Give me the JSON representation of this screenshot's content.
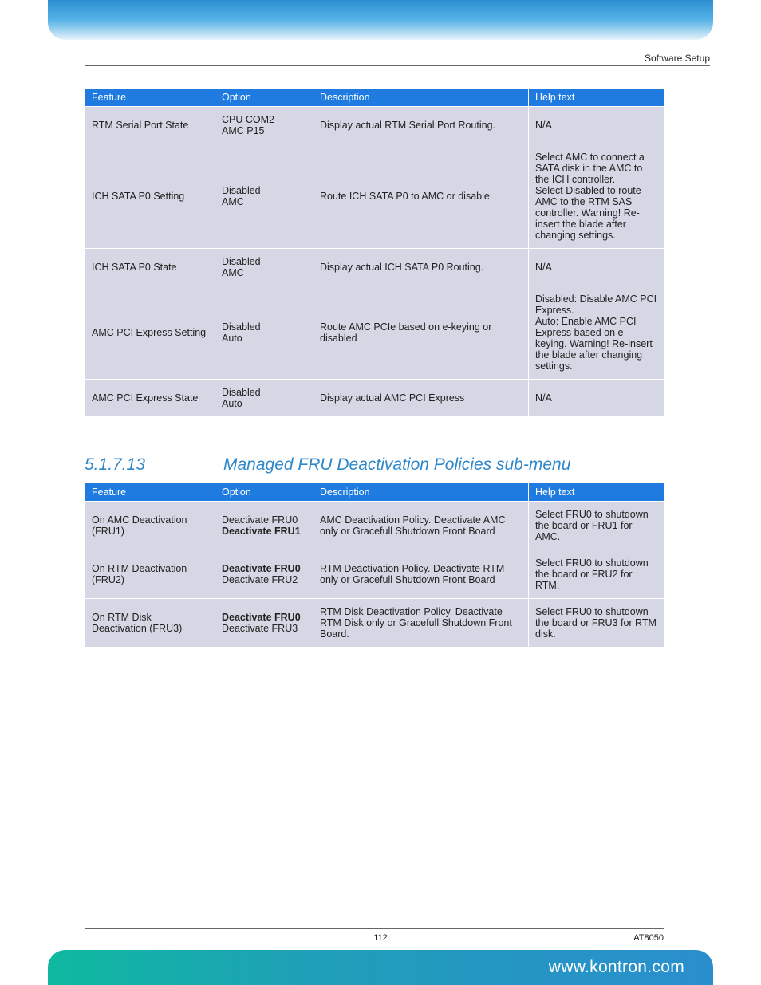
{
  "header": {
    "label": "Software Setup"
  },
  "table1": {
    "headers": [
      "Feature",
      "Option",
      "Description",
      "Help text"
    ],
    "rows": [
      {
        "feature": [
          "RTM Serial Port State"
        ],
        "option": [
          {
            "t": "CPU COM2"
          },
          {
            "t": "AMC P15"
          }
        ],
        "desc": [
          "Display actual RTM Serial Port Routing."
        ],
        "help": [
          "N/A"
        ]
      },
      {
        "feature": [
          "ICH SATA P0 Setting"
        ],
        "option": [
          {
            "t": "Disabled"
          },
          {
            "t": "AMC"
          }
        ],
        "desc": [
          "Route ICH SATA P0 to AMC or disable"
        ],
        "help": [
          "Select AMC to connect a SATA disk in the AMC to the ICH controller.",
          "Select Disabled to route AMC to the RTM SAS controller. Warning! Re-insert the blade after changing settings."
        ]
      },
      {
        "feature": [
          "ICH SATA P0 State"
        ],
        "option": [
          {
            "t": "Disabled"
          },
          {
            "t": "AMC"
          }
        ],
        "desc": [
          "Display actual ICH SATA P0 Routing."
        ],
        "help": [
          "N/A"
        ]
      },
      {
        "feature": [
          "AMC PCI Express Setting"
        ],
        "option": [
          {
            "t": "Disabled"
          },
          {
            "t": "Auto"
          }
        ],
        "desc": [
          "Route AMC PCIe based on e-keying or disabled"
        ],
        "help": [
          "Disabled: Disable AMC PCI Express.",
          "Auto: Enable AMC PCI Express based on e-keying. Warning! Re-insert the blade after changing settings."
        ]
      },
      {
        "feature": [
          "AMC PCI Express State"
        ],
        "option": [
          {
            "t": "Disabled"
          },
          {
            "t": "Auto"
          }
        ],
        "desc": [
          "Display actual AMC PCI Express"
        ],
        "help": [
          "N/A"
        ]
      }
    ]
  },
  "section": {
    "num": "5.1.7.13",
    "title": "Managed FRU Deactivation Policies sub-menu"
  },
  "table2": {
    "headers": [
      "Feature",
      "Option",
      "Description",
      "Help text"
    ],
    "rows": [
      {
        "feature": [
          "On AMC Deactivation (FRU1)"
        ],
        "option": [
          {
            "t": "Deactivate FRU0"
          },
          {
            "t": "Deactivate FRU1",
            "b": true
          }
        ],
        "desc": [
          "AMC Deactivation Policy. Deactivate AMC only or Gracefull Shutdown Front Board"
        ],
        "help": [
          "Select FRU0 to shutdown the board or FRU1 for AMC."
        ]
      },
      {
        "feature": [
          "On RTM Deactivation (FRU2)"
        ],
        "option": [
          {
            "t": "Deactivate FRU0",
            "b": true
          },
          {
            "t": "Deactivate FRU2"
          }
        ],
        "desc": [
          "RTM Deactivation Policy. Deactivate RTM only or Gracefull Shutdown Front Board"
        ],
        "help": [
          "Select FRU0 to shutdown the board or FRU2 for RTM."
        ]
      },
      {
        "feature": [
          "On RTM Disk Deactivation (FRU3)"
        ],
        "option": [
          {
            "t": "Deactivate FRU0",
            "b": true
          },
          {
            "t": "Deactivate FRU3"
          }
        ],
        "desc": [
          "RTM Disk Deactivation Policy. Deactivate RTM Disk only or Gracefull Shutdown Front Board."
        ],
        "help": [
          "Select FRU0 to shutdown the board or FRU3 for RTM disk."
        ]
      }
    ]
  },
  "footer": {
    "page": "112",
    "code": "AT8050",
    "url": "www.kontron.com"
  }
}
